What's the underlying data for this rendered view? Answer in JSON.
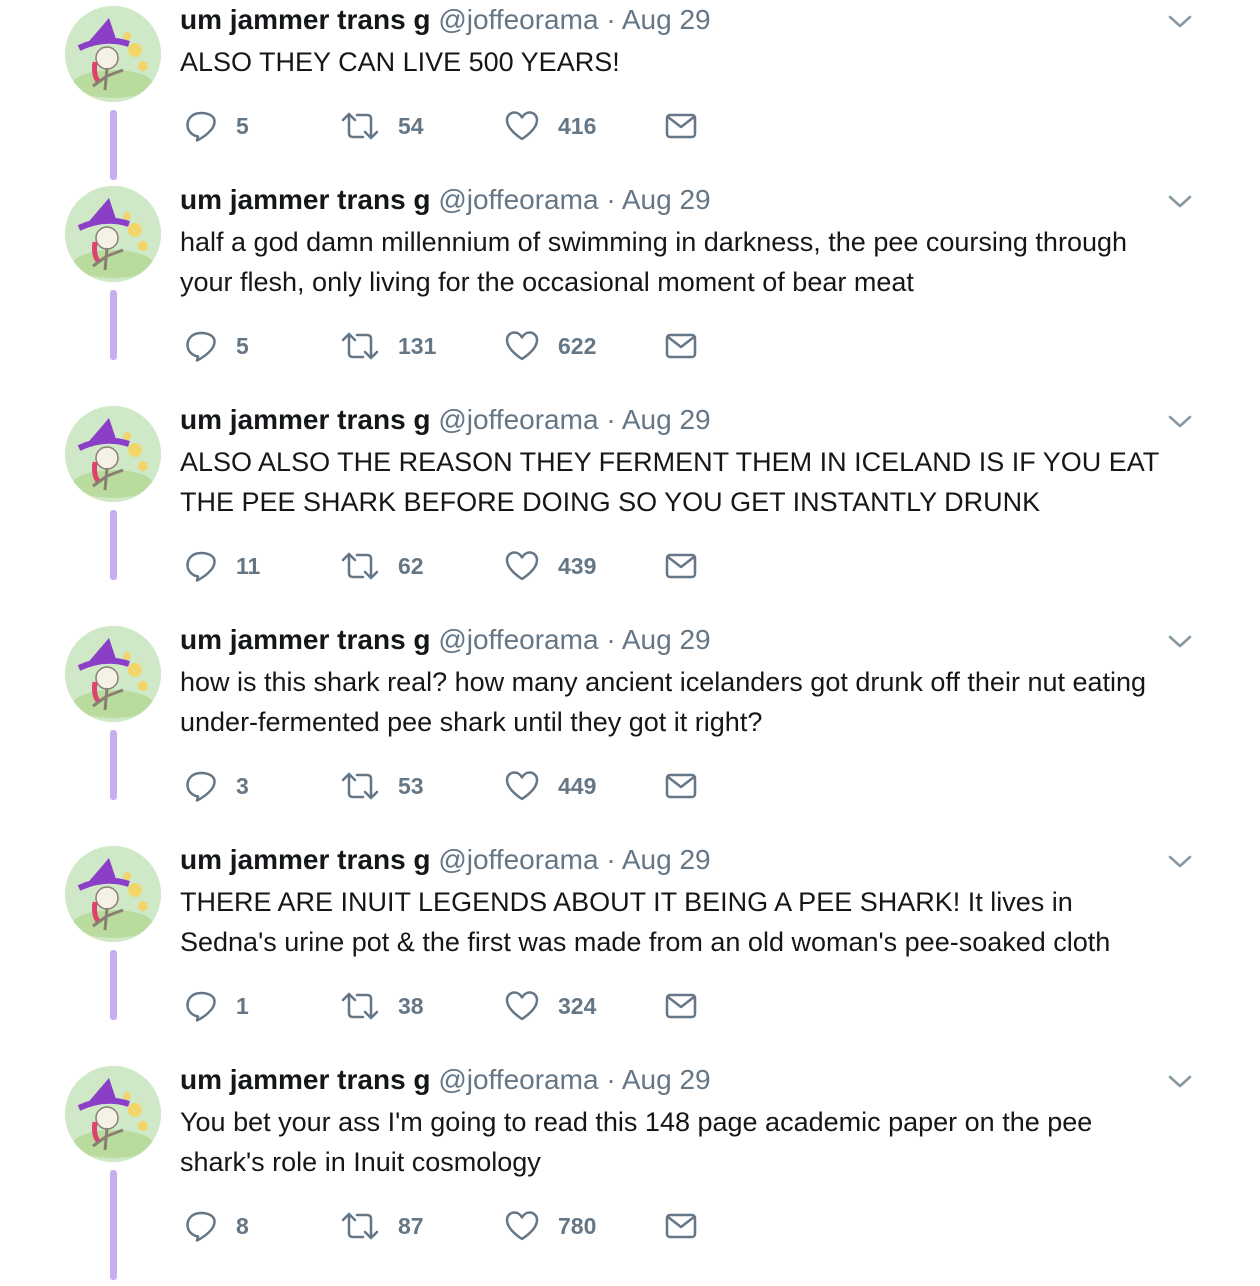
{
  "tweets": [
    {
      "name": "um jammer trans g",
      "handle": "@joffeorama",
      "separator": "·",
      "time": "Aug 29",
      "lines": [
        "ALSO THEY CAN LIVE 500 YEARS!"
      ],
      "replies": "5",
      "retweets": "54",
      "likes": "416"
    },
    {
      "name": "um jammer trans g",
      "handle": "@joffeorama",
      "separator": "·",
      "time": "Aug 29",
      "lines": [
        "half a god damn millennium of swimming in darkness, the pee coursing through",
        "your flesh, only living for the occasional moment of bear meat"
      ],
      "replies": "5",
      "retweets": "131",
      "likes": "622"
    },
    {
      "name": "um jammer trans g",
      "handle": "@joffeorama",
      "separator": "·",
      "time": "Aug 29",
      "lines": [
        "ALSO ALSO THE REASON THEY FERMENT THEM IN ICELAND IS IF YOU EAT",
        "THE PEE SHARK BEFORE DOING SO YOU GET INSTANTLY DRUNK"
      ],
      "replies": "11",
      "retweets": "62",
      "likes": "439"
    },
    {
      "name": "um jammer trans g",
      "handle": "@joffeorama",
      "separator": "·",
      "time": "Aug 29",
      "lines": [
        "how is this shark real? how many ancient icelanders got drunk off their nut eating",
        "under-fermented pee shark until they got it right?"
      ],
      "replies": "3",
      "retweets": "53",
      "likes": "449"
    },
    {
      "name": "um jammer trans g",
      "handle": "@joffeorama",
      "separator": "·",
      "time": "Aug 29",
      "lines": [
        "THERE ARE INUIT LEGENDS ABOUT IT BEING A PEE SHARK! It lives in",
        "Sedna's urine pot & the first was made from an old woman's pee-soaked cloth"
      ],
      "replies": "1",
      "retweets": "38",
      "likes": "324"
    },
    {
      "name": "um jammer trans g",
      "handle": "@joffeorama",
      "separator": "·",
      "time": "Aug 29",
      "lines": [
        "You bet your ass I'm going to read this 148 page academic paper on the pee",
        "shark's role in Inuit cosmology"
      ],
      "replies": "8",
      "retweets": "87",
      "likes": "780"
    }
  ],
  "icons": {
    "reply": "reply-icon",
    "retweet": "retweet-icon",
    "like": "heart-icon",
    "dm": "envelope-icon",
    "caret": "chevron-down-icon"
  },
  "colors": {
    "thread_line": "#c9aef2",
    "meta_text": "#657786",
    "body_text": "#14171a"
  }
}
